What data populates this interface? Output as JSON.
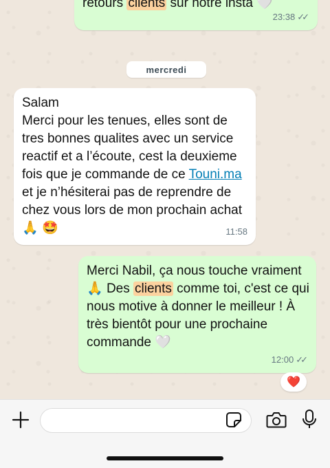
{
  "chat": {
    "date_separator": "mercredi",
    "messages": [
      {
        "id": "m1",
        "direction": "outgoing",
        "text_before": "retours ",
        "highlight": "clients",
        "text_after": " sur notre insta ",
        "emoji": "🤍",
        "time": "23:38",
        "status": "read"
      },
      {
        "id": "m2",
        "direction": "incoming",
        "line1": "Salam",
        "part1": "Merci pour les tenues, elles sont de tres bonnes qualites avec un service reactif et a l’écoute, cest la deuxieme fois que je commande de ce ",
        "link": "Touni.ma",
        "part2": " et je n’hésiterai pas de reprendre de chez vous lors de mon prochain achat ",
        "emoji1": "🙏",
        "emoji2": "🤩",
        "time": "11:58"
      },
      {
        "id": "m3",
        "direction": "outgoing",
        "part1": "Merci Nabil, ça nous touche vraiment ",
        "emoji1": "🙏",
        "part2": " Des ",
        "highlight": "clients",
        "part3": " comme toi, c'est ce qui nous motive à donner le meilleur ! À très bientôt pour une prochaine commande ",
        "emoji2": "🤍",
        "time": "12:00",
        "status": "read",
        "reaction": "❤️"
      }
    ]
  },
  "colors": {
    "outgoing_bubble": "#d9fdd3",
    "incoming_bubble": "#ffffff",
    "highlight": "#fcd29f",
    "link": "#027eb5"
  },
  "icons": {
    "attach": "plus-icon",
    "sticker": "sticker-icon",
    "camera": "camera-icon",
    "mic": "microphone-icon"
  }
}
